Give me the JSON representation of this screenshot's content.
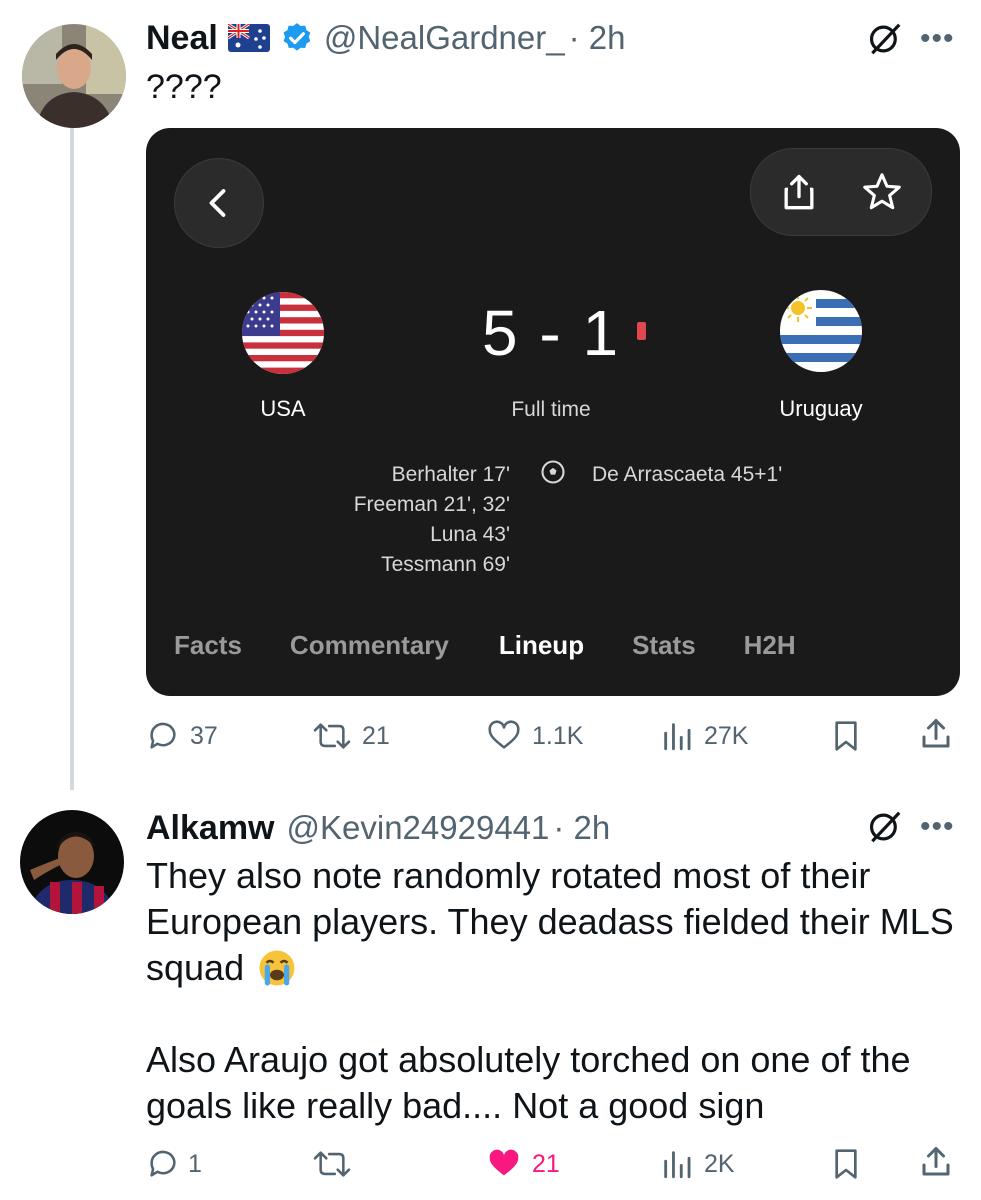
{
  "tweet1": {
    "name": "Neal",
    "handle": "@NealGardner_",
    "time": "· 2h",
    "text": "????",
    "card": {
      "home_team": "USA",
      "away_team": "Uruguay",
      "score": "5 - 1",
      "status": "Full time",
      "home_scorers": [
        "Berhalter 17'",
        "Freeman 21', 32'",
        "Luna 43'",
        "Tessmann 69'"
      ],
      "away_scorers": [
        "De Arrascaeta 45+1'"
      ],
      "tabs": [
        "Facts",
        "Commentary",
        "Lineup",
        "Stats",
        "H2H"
      ],
      "active_tab": "Lineup"
    },
    "actions": {
      "replies": "37",
      "reposts": "21",
      "likes": "1.1K",
      "views": "27K"
    }
  },
  "tweet2": {
    "name": "Alkamw",
    "handle": "@Kevin24929441",
    "time": "· 2h",
    "text_p1_line1": "They also note randomly rotated most of their",
    "text_p1_line2": "European players. They deadass fielded their MLS",
    "text_p1_line3": "squad",
    "text_p2_line1": "Also Araujo got absolutely torched on one of the",
    "text_p2_line2": "goals like really bad.... Not a good sign",
    "actions": {
      "replies": "1",
      "reposts": "",
      "likes": "21",
      "views": "2K"
    },
    "liked": true
  },
  "colors": {
    "like_active": "#f91880",
    "verified": "#1d9bf0",
    "live_dot": "#e0484f"
  }
}
